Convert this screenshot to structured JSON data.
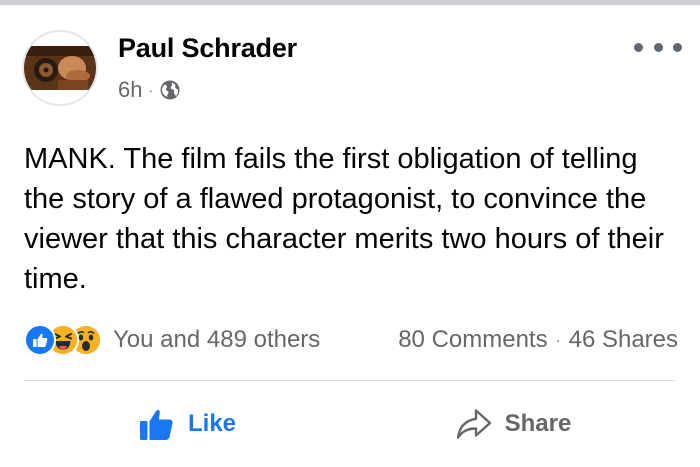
{
  "post": {
    "author": "Paul Schrader",
    "time": "6h",
    "separator": "·",
    "audience_icon": "globe-icon",
    "more_icon": "more-options-icon",
    "text": "MANK. The film fails the first obligation of telling the story of a flawed protagonist, to convince the viewer that this character merits two hours of their time."
  },
  "reactions": {
    "icons": [
      "like-reaction-icon",
      "haha-reaction-icon",
      "wow-reaction-icon"
    ],
    "summary": "You and 489 others",
    "comments": "80 Comments",
    "stats_separator": "·",
    "shares": "46 Shares"
  },
  "actions": {
    "like_label": "Like",
    "share_label": "Share"
  },
  "colors": {
    "facebook_blue": "#1877f2",
    "secondary_text": "#65676b",
    "divider": "#dadde1",
    "reaction_yellow": "#f7b125"
  }
}
